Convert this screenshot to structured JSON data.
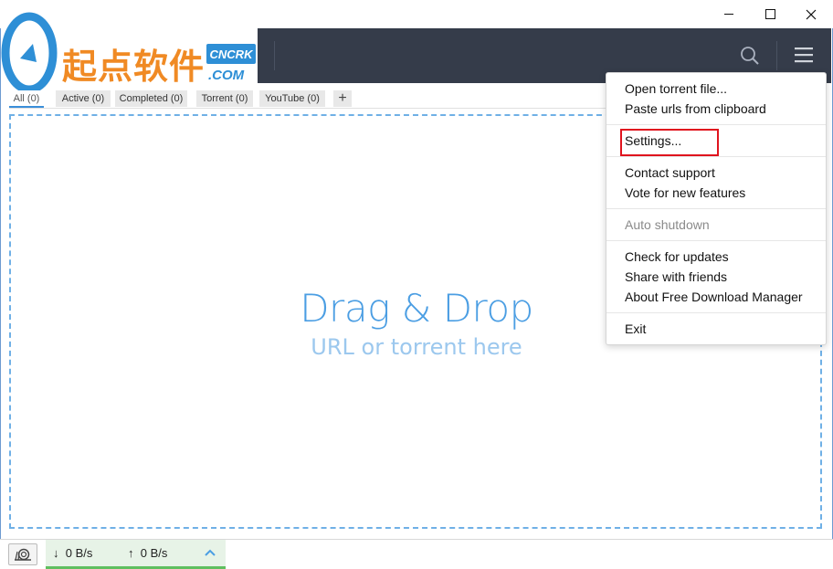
{
  "window": {
    "controls": {
      "minimize": "minimize",
      "maximize": "maximize",
      "close": "close"
    }
  },
  "watermark": {
    "text": "起点软件",
    "badge": "CNCRK",
    "domain": ".COM"
  },
  "tabs": [
    {
      "label": "All (0)",
      "active": true
    },
    {
      "label": "Active (0)"
    },
    {
      "label": "Completed (0)"
    },
    {
      "label": "Torrent (0)"
    },
    {
      "label": "YouTube (0)"
    }
  ],
  "tab_add_label": "+",
  "dropzone": {
    "title": "Drag & Drop",
    "subtitle": "URL or torrent here"
  },
  "statusbar": {
    "download_speed": "0 B/s",
    "upload_speed": "0 B/s",
    "down_arrow": "↓",
    "up_arrow": "↑"
  },
  "menu": {
    "items": [
      {
        "label": "Open torrent file..."
      },
      {
        "label": "Paste urls from clipboard"
      },
      {
        "label": "Settings..."
      },
      {
        "label": "Contact support"
      },
      {
        "label": "Vote for new features"
      },
      {
        "label": "Auto shutdown",
        "disabled": true
      },
      {
        "label": "Check for updates"
      },
      {
        "label": "Share with friends"
      },
      {
        "label": "About Free Download Manager"
      },
      {
        "label": "Exit"
      }
    ]
  },
  "icons": {
    "search": "search-icon",
    "menu": "hamburger-menu-icon",
    "snail": "snail-icon",
    "chevron": "chevron-up-icon"
  },
  "colors": {
    "toolbar": "#353c4a",
    "accent": "#4b9ee3",
    "highlight": "#e0141e",
    "speed_bar": "#5fbf5f"
  }
}
